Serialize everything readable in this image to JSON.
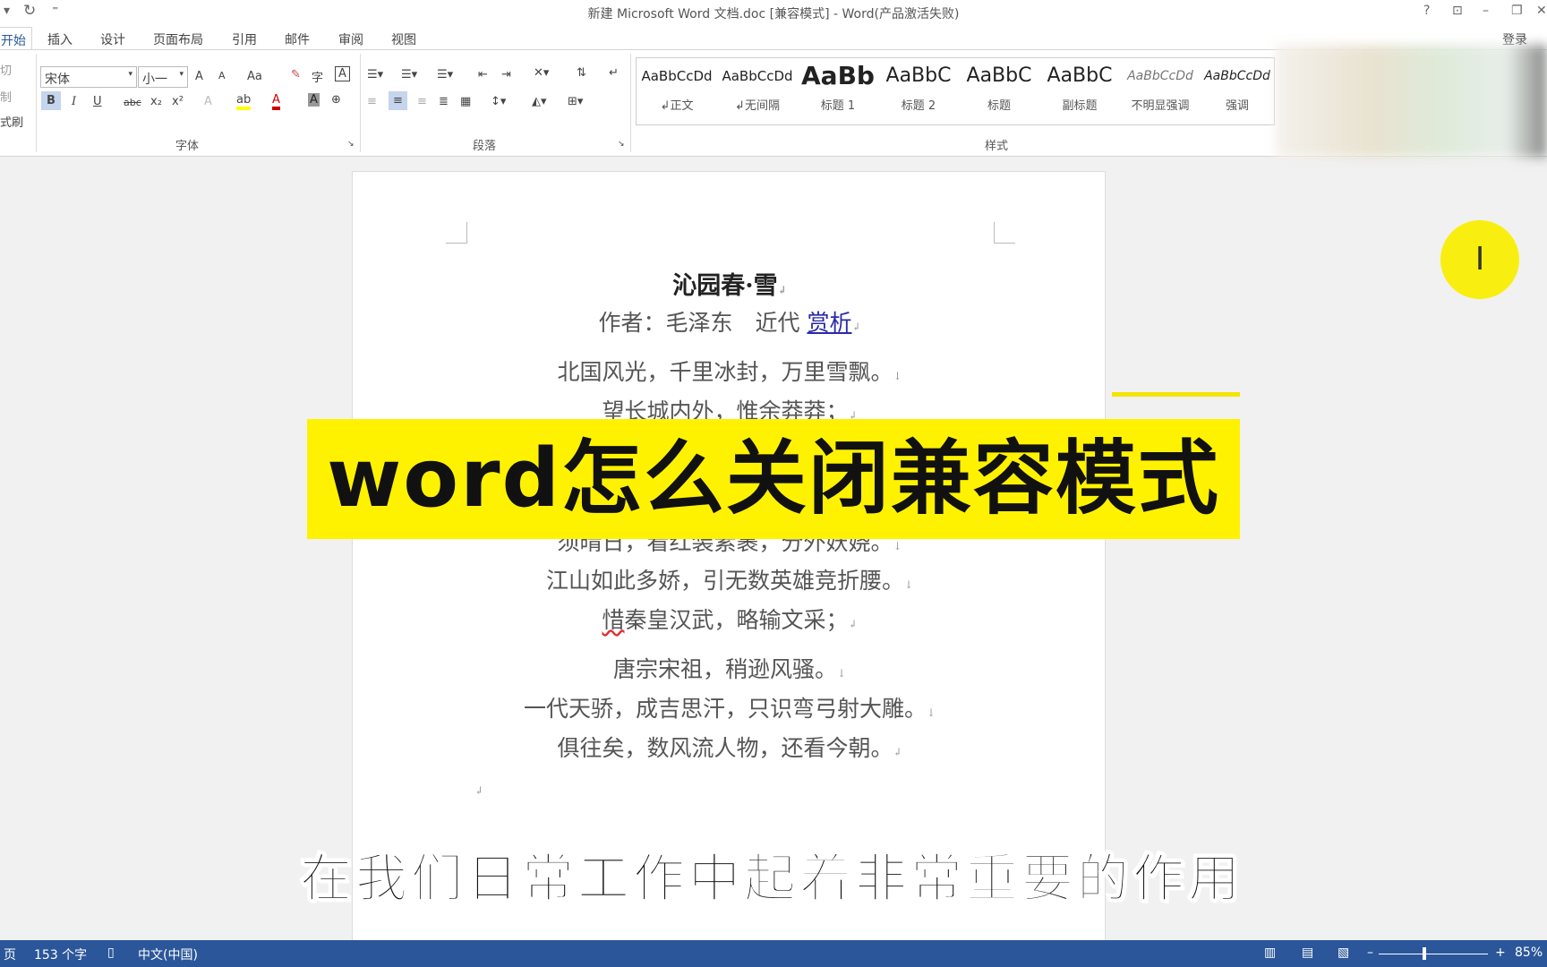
{
  "window": {
    "title": "新建 Microsoft Word 文档.doc [兼容模式] - Word(产品激活失败)",
    "help": "?",
    "ribbon_display": "⊡",
    "minimize": "–",
    "restore": "❐",
    "close": "✕",
    "signin": "登录"
  },
  "tabs": [
    "开始",
    "插入",
    "设计",
    "页面布局",
    "引用",
    "邮件",
    "审阅",
    "视图"
  ],
  "ribbon": {
    "clipboard": [
      "切",
      "制",
      "式刷"
    ],
    "font": {
      "name": "宋体",
      "size": "小一",
      "grow": "A",
      "shrink": "A",
      "case": "Aa",
      "group_label": "字体",
      "bold": "B",
      "italic": "I",
      "underline": "U",
      "strike": "abc",
      "sub": "x₂",
      "sup": "x²",
      "color_a": "A"
    },
    "paragraph": {
      "group_label": "段落"
    },
    "styles": {
      "group_label": "样式",
      "items": [
        {
          "preview": "AaBbCcDd",
          "label": "↲正文"
        },
        {
          "preview": "AaBbCcDd",
          "label": "↲无间隔"
        },
        {
          "preview": "AaBb",
          "label": "标题 1"
        },
        {
          "preview": "AaBbC",
          "label": "标题 2"
        },
        {
          "preview": "AaBbC",
          "label": "标题"
        },
        {
          "preview": "AaBbC",
          "label": "副标题"
        },
        {
          "preview": "AaBbCcDd",
          "label": "不明显强调"
        },
        {
          "preview": "AaBbCcDd",
          "label": "强调"
        }
      ]
    }
  },
  "document": {
    "title": "沁园春·雪",
    "author_line": "作者：毛泽东　近代",
    "author_link": "赏析",
    "lines": [
      "北国风光，千里冰封，万里雪飘。",
      "望长城内外，惟余莽莽；",
      "须晴日，看红装素裹，分外妖娆。",
      "江山如此多娇，引无数英雄竞折腰。",
      "秦皇汉武，略输文采；",
      "唐宗宋祖，稍逊风骚。",
      "一代天骄，成吉思汗，只识弯弓射大雕。",
      "俱往矣，数风流人物，还看今朝。"
    ],
    "misspelled": "惜"
  },
  "overlay": {
    "banner": "word怎么关闭兼容模式",
    "subtitle": "在我们日常工作中起着非常重要的作用",
    "cursor": "I",
    "banner_color": "#fff200"
  },
  "status": {
    "page": "页",
    "words": "153 个字",
    "language": "中文(中国)",
    "zoom": "85%",
    "zoom_minus": "–",
    "zoom_plus": "+",
    "zoom_percent": 85,
    "bar_color": "#2b579a"
  }
}
